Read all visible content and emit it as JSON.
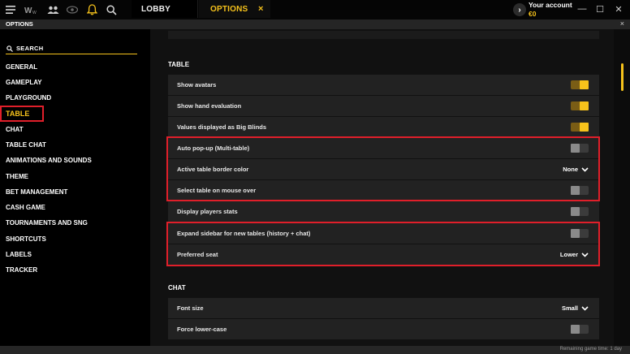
{
  "topbar": {
    "tabs": [
      {
        "label": "LOBBY"
      },
      {
        "label": "OPTIONS"
      }
    ],
    "tab_close": "×",
    "account": {
      "title": "Your account",
      "balance": "€0",
      "arrow": "›"
    },
    "window": {
      "minimize": "—",
      "maximize": "☐",
      "close": "✕"
    }
  },
  "subheader": {
    "title": "OPTIONS",
    "close": "×"
  },
  "sidebar": {
    "search_label": "SEARCH",
    "items": [
      {
        "label": "GENERAL"
      },
      {
        "label": "GAMEPLAY"
      },
      {
        "label": "PLAYGROUND"
      },
      {
        "label": "TABLE"
      },
      {
        "label": "CHAT"
      },
      {
        "label": "TABLE CHAT"
      },
      {
        "label": "ANIMATIONS AND SOUNDS"
      },
      {
        "label": "THEME"
      },
      {
        "label": "BET MANAGEMENT"
      },
      {
        "label": "CASH GAME"
      },
      {
        "label": "TOURNAMENTS AND SNG"
      },
      {
        "label": "SHORTCUTS"
      },
      {
        "label": "LABELS"
      },
      {
        "label": "TRACKER"
      }
    ],
    "active_index": 3
  },
  "sections": {
    "table": {
      "title": "TABLE",
      "rows": [
        {
          "label": "Show avatars",
          "type": "toggle",
          "on": true
        },
        {
          "label": "Show hand evaluation",
          "type": "toggle",
          "on": true
        },
        {
          "label": "Values displayed as Big Blinds",
          "type": "toggle",
          "on": true
        },
        {
          "label": "Auto pop-up (Multi-table)",
          "type": "toggle",
          "on": false
        },
        {
          "label": "Active table border color",
          "type": "dropdown",
          "value": "None"
        },
        {
          "label": "Select table on mouse over",
          "type": "toggle",
          "on": false
        },
        {
          "label": "Display players stats",
          "type": "toggle",
          "on": false
        },
        {
          "label": "Expand sidebar for new tables (history + chat)",
          "type": "toggle",
          "on": false
        },
        {
          "label": "Preferred seat",
          "type": "dropdown",
          "value": "Lower"
        }
      ]
    },
    "chat": {
      "title": "CHAT",
      "rows": [
        {
          "label": "Font size",
          "type": "dropdown",
          "value": "Small"
        },
        {
          "label": "Force lower-case",
          "type": "toggle",
          "on": false
        }
      ]
    }
  },
  "footer": {
    "text": "Remaining game time: 1 day"
  },
  "colors": {
    "accent": "#f6c21b",
    "highlight": "#e01f2a",
    "row_bg": "#222222",
    "background": "#111111"
  },
  "icons": [
    "menu-icon",
    "tables-icon",
    "friends-icon",
    "eye-icon",
    "bell-icon",
    "search-icon"
  ]
}
